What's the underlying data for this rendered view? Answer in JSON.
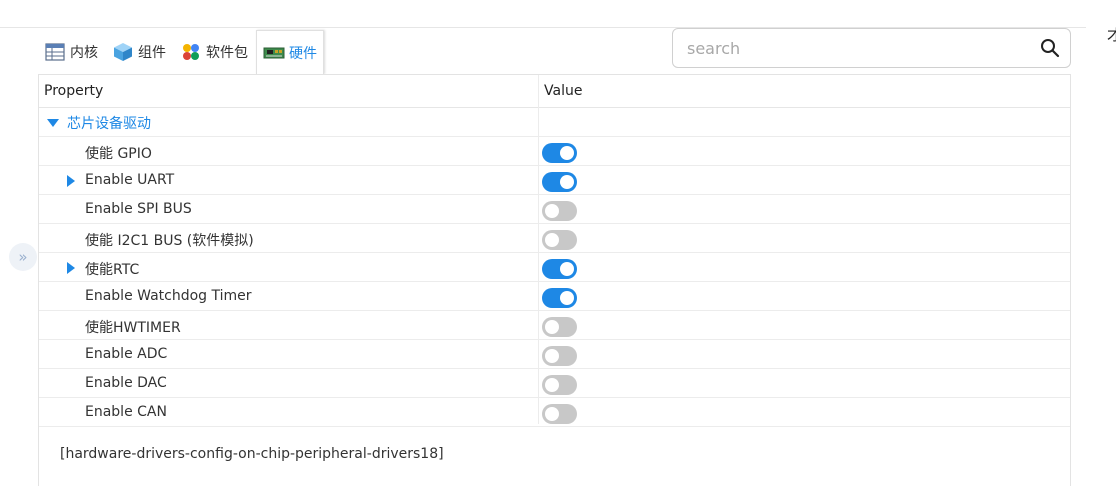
{
  "tabs": [
    {
      "label": "内核",
      "icon": "kernel-icon",
      "active": false
    },
    {
      "label": "组件",
      "icon": "component-cube-icon",
      "active": false
    },
    {
      "label": "软件包",
      "icon": "packages-icon",
      "active": false
    },
    {
      "label": "硬件",
      "icon": "hardware-board-icon",
      "active": true
    }
  ],
  "search": {
    "placeholder": "search",
    "value": ""
  },
  "edge_char": "才",
  "table": {
    "headers": {
      "property": "Property",
      "value": "Value"
    },
    "group": {
      "label": "芯片设备驱动",
      "expanded": true
    },
    "rows": [
      {
        "label": "使能 GPIO",
        "enabled": true,
        "expandable": false
      },
      {
        "label": "Enable UART",
        "enabled": true,
        "expandable": true
      },
      {
        "label": "Enable SPI BUS",
        "enabled": false,
        "expandable": false
      },
      {
        "label": "使能 I2C1 BUS (软件模拟)",
        "enabled": false,
        "expandable": false
      },
      {
        "label": "使能RTC",
        "enabled": true,
        "expandable": true
      },
      {
        "label": "Enable Watchdog Timer",
        "enabled": true,
        "expandable": false
      },
      {
        "label": "使能HWTIMER",
        "enabled": false,
        "expandable": false
      },
      {
        "label": "Enable ADC",
        "enabled": false,
        "expandable": false
      },
      {
        "label": "Enable DAC",
        "enabled": false,
        "expandable": false
      },
      {
        "label": "Enable CAN",
        "enabled": false,
        "expandable": false
      }
    ]
  },
  "description": "[hardware-drivers-config-on-chip-peripheral-drivers18]",
  "colors": {
    "accent": "#1e88e5",
    "toggle_off": "#c8c8c8"
  }
}
